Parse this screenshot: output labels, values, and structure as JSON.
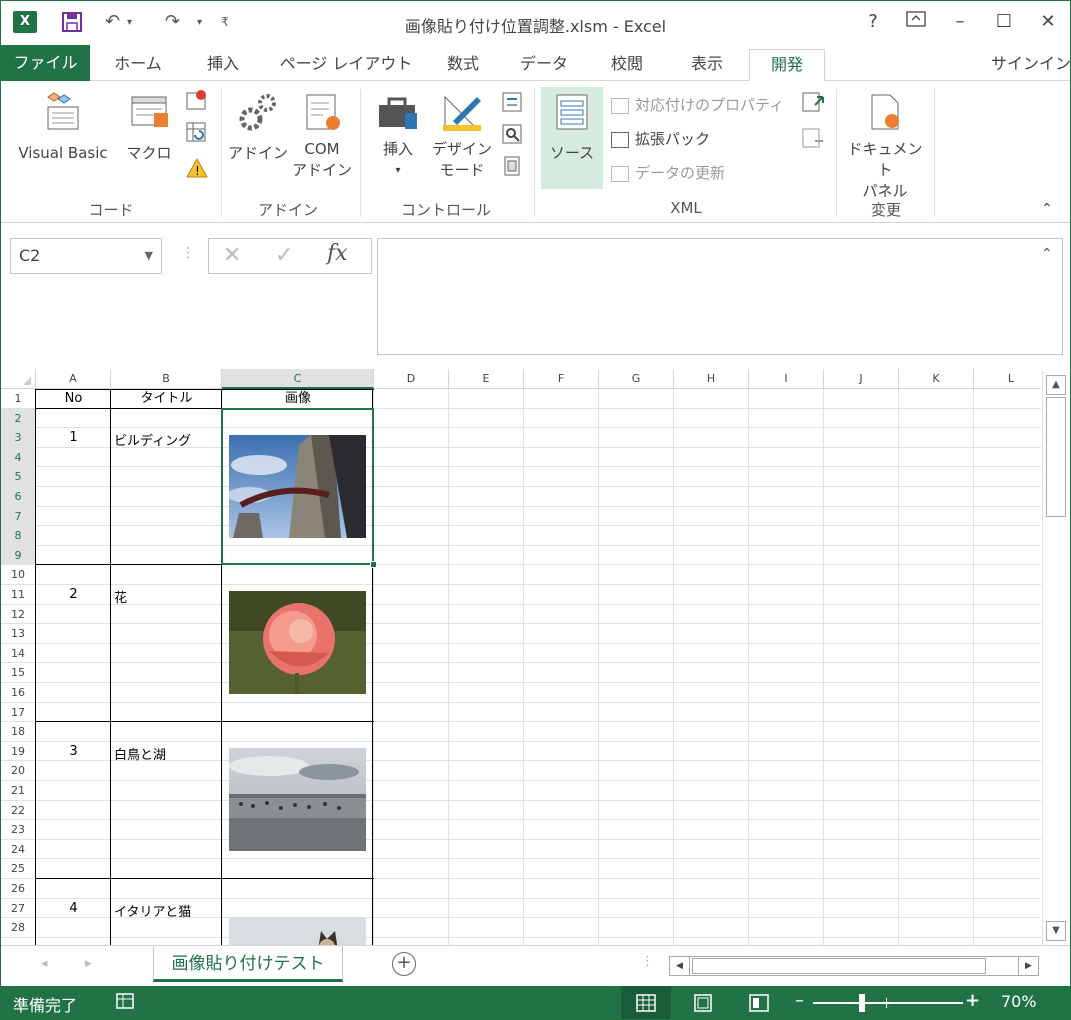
{
  "window": {
    "app_letter": "X",
    "title": "画像貼り付け位置調整.xlsm - Excel"
  },
  "tabs": [
    {
      "label": "ファイル"
    },
    {
      "label": "ホーム"
    },
    {
      "label": "挿入"
    },
    {
      "label": "ページ レイアウト"
    },
    {
      "label": "数式"
    },
    {
      "label": "データ"
    },
    {
      "label": "校閲"
    },
    {
      "label": "表示"
    },
    {
      "label": "開発"
    }
  ],
  "signin": "サインイン",
  "ribbon": {
    "code": {
      "visual_basic": "Visual Basic",
      "macro": "マクロ",
      "group": "コード"
    },
    "addins": {
      "addin": "アドイン",
      "com_addin_1": "COM",
      "com_addin_2": "アドイン",
      "group": "アドイン"
    },
    "controls": {
      "insert": "挿入",
      "design_mode_1": "デザイン",
      "design_mode_2": "モード",
      "group": "コントロール"
    },
    "xml": {
      "source": "ソース",
      "map_properties": "対応付けのプロパティ",
      "expansion_pack": "拡張パック",
      "refresh_data": "データの更新",
      "group": "XML"
    },
    "modify": {
      "doc_panel_1": "ドキュメント",
      "doc_panel_2": "パネル",
      "group": "変更"
    }
  },
  "formula_bar": {
    "name_box": "C2",
    "fx": "fx",
    "content": ""
  },
  "columns": [
    "A",
    "B",
    "C",
    "D",
    "E",
    "F",
    "G",
    "H",
    "I",
    "J",
    "K",
    "L"
  ],
  "selected_column": "C",
  "rows": [
    "1",
    "2",
    "3",
    "4",
    "5",
    "6",
    "7",
    "8",
    "9",
    "10",
    "11",
    "12",
    "13",
    "14",
    "15",
    "16",
    "17",
    "18",
    "19",
    "20",
    "21",
    "22",
    "23",
    "24",
    "25",
    "26",
    "27",
    "28"
  ],
  "table": {
    "headers": [
      "No",
      "タイトル",
      "画像"
    ],
    "records": [
      {
        "no": "1",
        "title": "ビルディング",
        "image": "building-photo"
      },
      {
        "no": "2",
        "title": "花",
        "image": "rose-photo"
      },
      {
        "no": "3",
        "title": "白鳥と湖",
        "image": "swans-lake-photo"
      },
      {
        "no": "4",
        "title": "イタリアと猫",
        "image": "cat-photo"
      }
    ]
  },
  "sheet_tab": "画像貼り付けテスト",
  "status": {
    "ready": "準備完了",
    "zoom": "70%"
  },
  "colors": {
    "accent": "#217346",
    "source_highlight": "#d5ebdf"
  }
}
